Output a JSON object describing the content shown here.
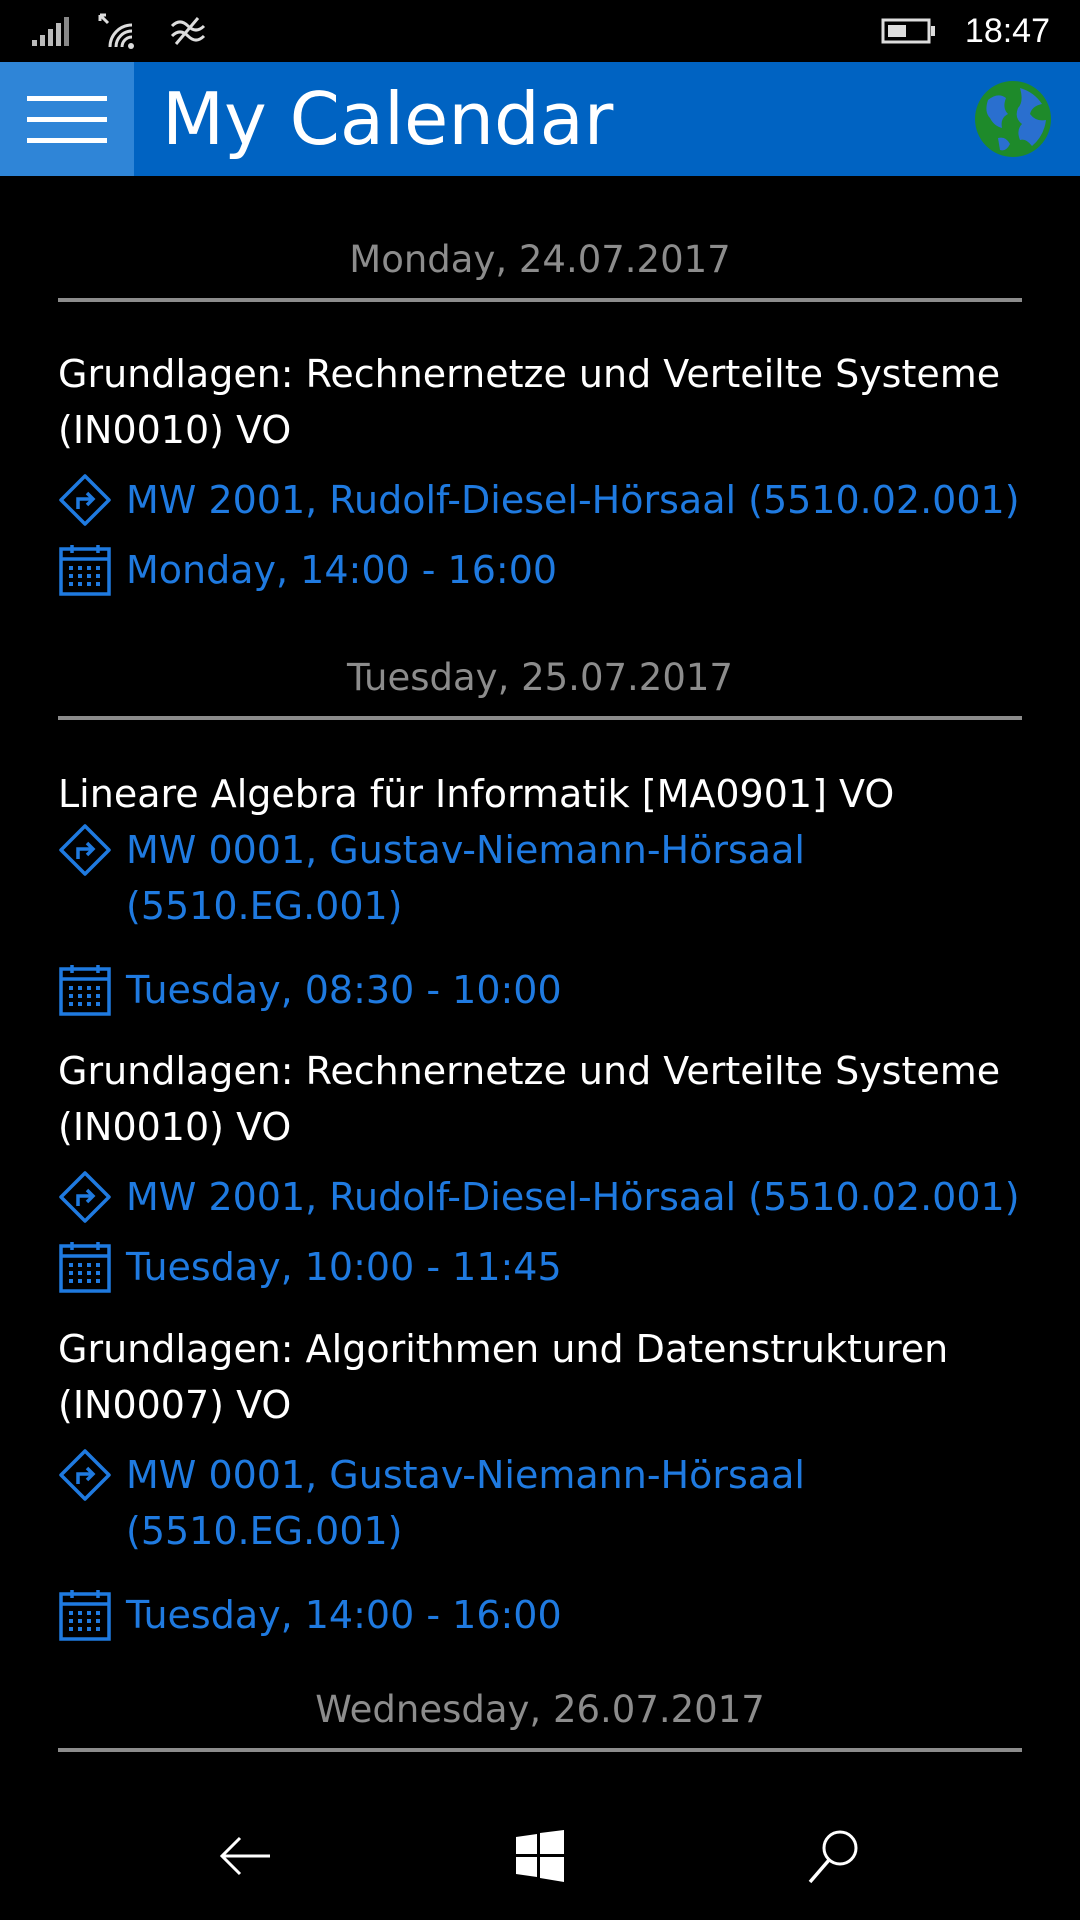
{
  "status": {
    "time": "18:47"
  },
  "header": {
    "title": "My Calendar"
  },
  "days": [
    {
      "label": "Monday, 24.07.2017",
      "events": [
        {
          "title_lines": [
            "Grundlagen: Rechnernetze und Verteilte Systeme",
            "(IN0010) VO"
          ],
          "location_lines": [
            "MW 2001, Rudolf-Diesel-Hörsaal (5510.02.001)"
          ],
          "time": "Monday, 14:00 - 16:00"
        }
      ]
    },
    {
      "label": "Tuesday, 25.07.2017",
      "events": [
        {
          "title_lines": [
            "Lineare Algebra für Informatik [MA0901] VO"
          ],
          "location_lines": [
            "MW 0001, Gustav-Niemann-Hörsaal",
            "(5510.EG.001)"
          ],
          "time": "Tuesday, 08:30 - 10:00"
        },
        {
          "title_lines": [
            "Grundlagen: Rechnernetze und Verteilte Systeme",
            "(IN0010) VO"
          ],
          "location_lines": [
            "MW 2001, Rudolf-Diesel-Hörsaal (5510.02.001)"
          ],
          "time": "Tuesday, 10:00 - 11:45"
        },
        {
          "title_lines": [
            "Grundlagen: Algorithmen und Datenstrukturen",
            "(IN0007) VO"
          ],
          "location_lines": [
            "MW 0001, Gustav-Niemann-Hörsaal",
            "(5510.EG.001)"
          ],
          "time": "Tuesday, 14:00 - 16:00"
        }
      ]
    },
    {
      "label": "Wednesday, 26.07.2017",
      "events": []
    }
  ],
  "colors": {
    "accent": "#0063c2",
    "menu": "#2f85d7",
    "link": "#1f7ae0",
    "muted": "#8c8c8c"
  },
  "icons": [
    "signal-icon",
    "wifi-icon",
    "cellular-data-icon",
    "battery-icon",
    "menu-icon",
    "globe-icon",
    "directions-icon",
    "calendar-icon",
    "back-icon",
    "windows-icon",
    "search-icon"
  ]
}
